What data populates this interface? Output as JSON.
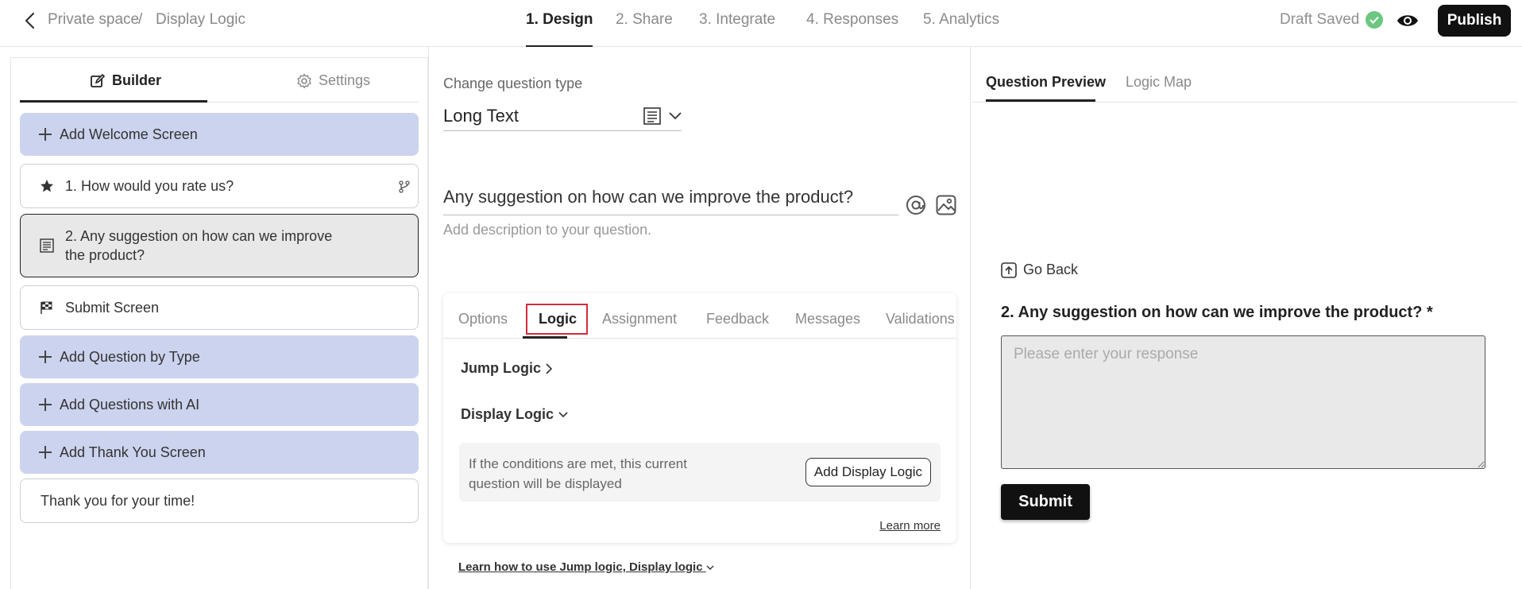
{
  "breadcrumb": {
    "space": "Private space",
    "separator": "/",
    "page": "Display Logic"
  },
  "steps": [
    {
      "label": "1. Design"
    },
    {
      "label": "2. Share"
    },
    {
      "label": "3. Integrate"
    },
    {
      "label": "4. Responses"
    },
    {
      "label": "5. Analytics"
    }
  ],
  "status": {
    "draft": "Draft Saved"
  },
  "publish_label": "Publish",
  "left": {
    "tabs": {
      "builder": "Builder",
      "settings": "Settings"
    },
    "items": [
      {
        "label": "Add Welcome Screen"
      },
      {
        "label": "1. How would you rate us?"
      },
      {
        "label": "2. Any suggestion on how can we improve the product?"
      },
      {
        "label": "Submit Screen"
      },
      {
        "label": "Add Question by Type"
      },
      {
        "label": "Add Questions with AI"
      },
      {
        "label": "Add Thank You Screen"
      },
      {
        "label": "Thank you for your time!"
      }
    ]
  },
  "middle": {
    "change_label": "Change question type",
    "question_type": "Long Text",
    "question_title": "Any suggestion on how can we improve the product?",
    "description_placeholder": "Add description to your question.",
    "tabs": [
      "Options",
      "Logic",
      "Assignment",
      "Feedback",
      "Messages",
      "Validations"
    ],
    "jump_logic": "Jump Logic",
    "display_logic": "Display Logic",
    "condition_text": "If the conditions are met, this current question will be displayed",
    "add_display_logic": "Add Display Logic",
    "learn_more": "Learn more",
    "learn_how": "Learn how to use Jump logic, Display logic"
  },
  "right": {
    "tabs": {
      "preview": "Question Preview",
      "map": "Logic Map"
    },
    "go_back": "Go Back",
    "question": "2. Any suggestion on how can we improve the product? *",
    "placeholder": "Please enter your response",
    "submit": "Submit"
  }
}
